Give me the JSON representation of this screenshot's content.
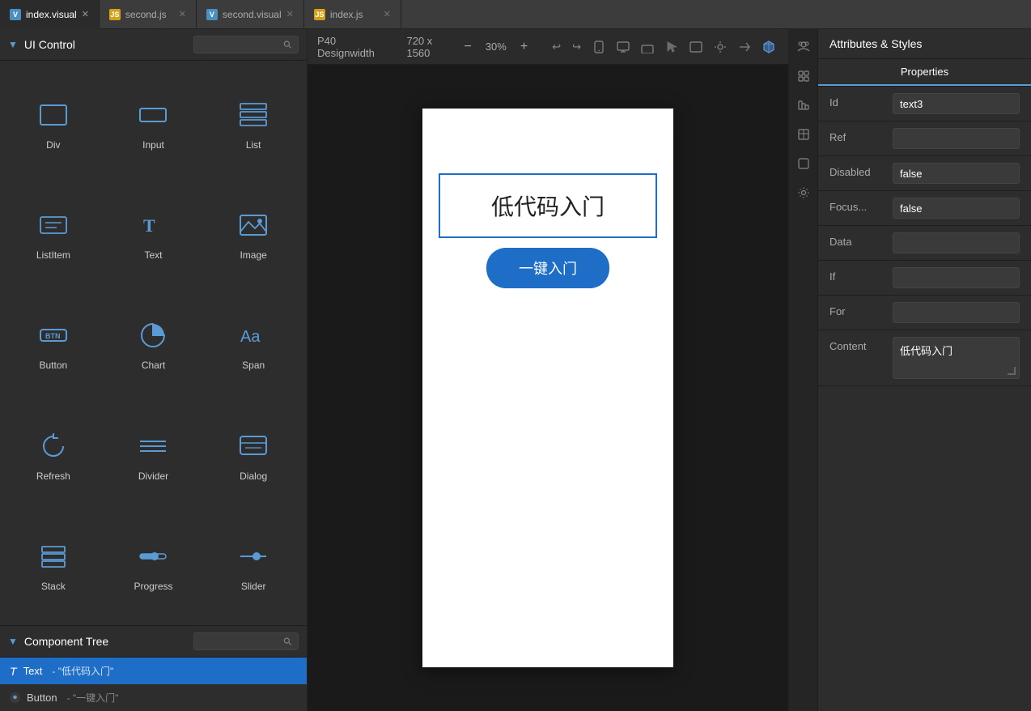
{
  "tabs": [
    {
      "id": "tab-index-visual",
      "label": "index.visual",
      "type": "visual",
      "active": true
    },
    {
      "id": "tab-second-js",
      "label": "second.js",
      "type": "js",
      "active": false
    },
    {
      "id": "tab-second-visual",
      "label": "second.visual",
      "type": "visual",
      "active": false
    },
    {
      "id": "tab-index-js",
      "label": "index.js",
      "type": "js",
      "active": false
    }
  ],
  "left_panel": {
    "ui_control": {
      "title": "UI Control",
      "search_placeholder": "",
      "components": [
        {
          "id": "div",
          "label": "Div"
        },
        {
          "id": "input",
          "label": "Input"
        },
        {
          "id": "list",
          "label": "List"
        },
        {
          "id": "listitem",
          "label": "ListItem"
        },
        {
          "id": "text",
          "label": "Text"
        },
        {
          "id": "image",
          "label": "Image"
        },
        {
          "id": "button",
          "label": "Button"
        },
        {
          "id": "chart",
          "label": "Chart"
        },
        {
          "id": "span",
          "label": "Span"
        },
        {
          "id": "refresh",
          "label": "Refresh"
        },
        {
          "id": "divider",
          "label": "Divider"
        },
        {
          "id": "dialog",
          "label": "Dialog"
        },
        {
          "id": "stack",
          "label": "Stack"
        },
        {
          "id": "progress",
          "label": "Progress"
        },
        {
          "id": "slider",
          "label": "Slider"
        }
      ]
    },
    "component_tree": {
      "title": "Component Tree",
      "search_placeholder": "",
      "items": [
        {
          "id": "tree-text",
          "icon": "T",
          "name": "Text",
          "value": "- \"低代码入门\"",
          "selected": true
        },
        {
          "id": "tree-button",
          "icon": "btn",
          "name": "Button",
          "value": "- \"一键入门\"",
          "selected": false
        }
      ]
    }
  },
  "canvas": {
    "device_name": "P40 Designwidth",
    "dimensions": "720 x 1560",
    "zoom": "30%",
    "text_content": "低代码入门",
    "button_label": "一键入门"
  },
  "right_panel": {
    "title": "Attributes & Styles",
    "tab_active": "Properties",
    "properties": {
      "id_label": "Id",
      "id_value": "text3",
      "ref_label": "Ref",
      "ref_value": "",
      "disabled_label": "Disabled",
      "disabled_value": "false",
      "focus_label": "Focus...",
      "focus_value": "false",
      "data_label": "Data",
      "data_value": "",
      "if_label": "If",
      "if_value": "",
      "for_label": "For",
      "for_value": "",
      "content_label": "Content",
      "content_value": "低代码入门"
    }
  }
}
